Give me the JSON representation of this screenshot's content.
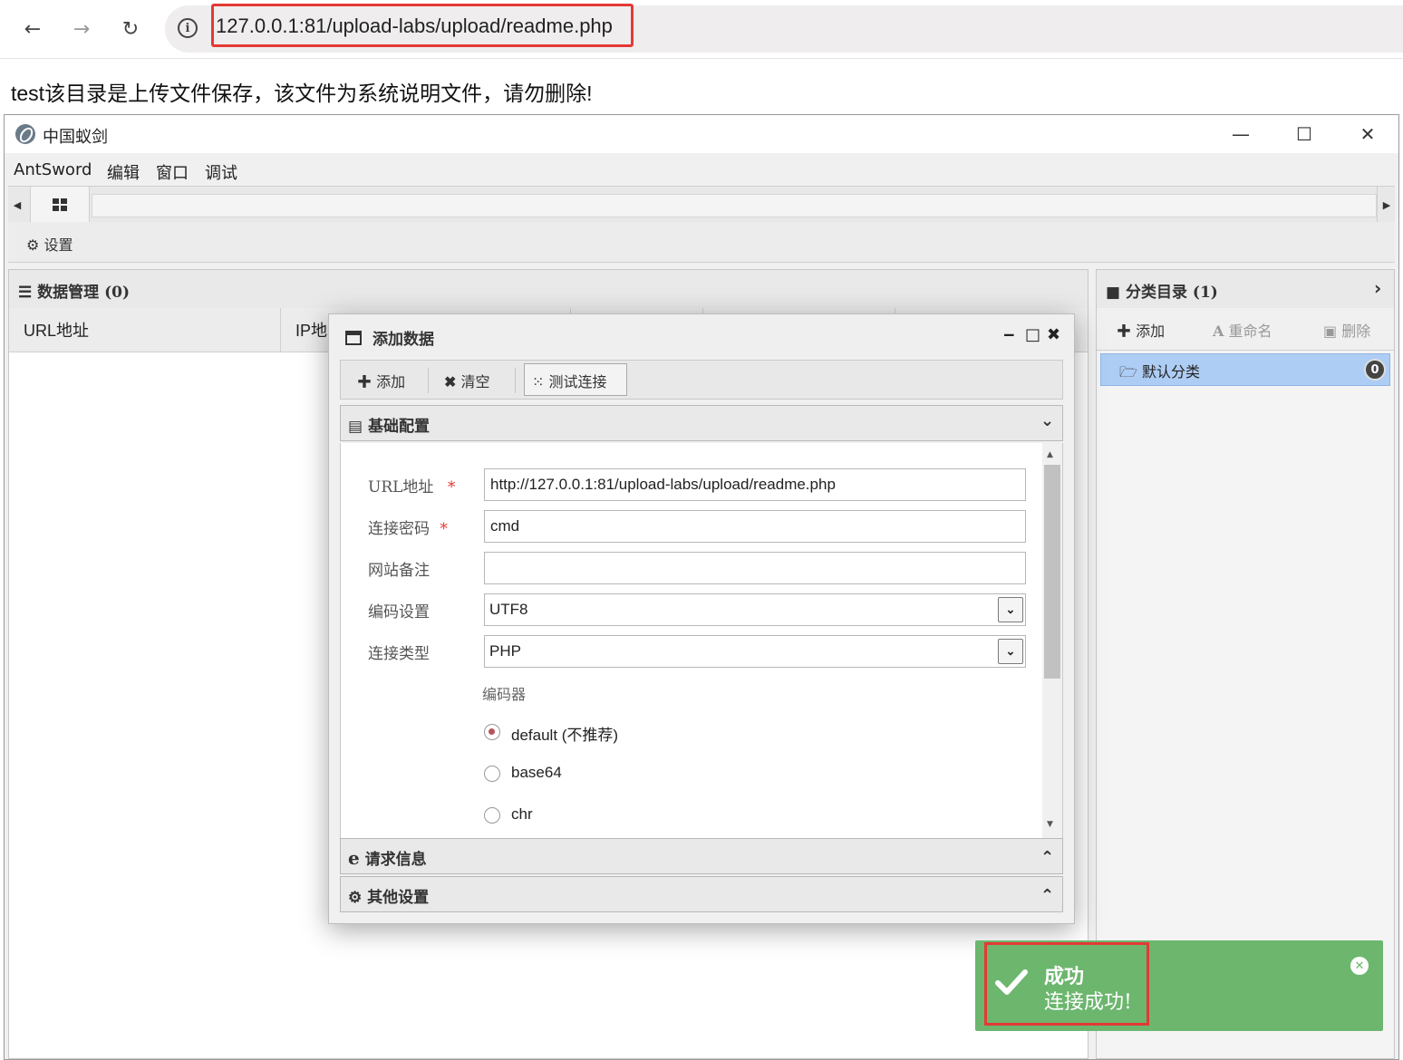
{
  "browser": {
    "url": "127.0.0.1:81/upload-labs/upload/readme.php"
  },
  "page": {
    "text": "test该目录是上传文件保存，该文件为系统说明文件，请勿删除!"
  },
  "app": {
    "title": "中国蚁剑",
    "menu": [
      "AntSword",
      "编辑",
      "窗口",
      "调试"
    ],
    "settings_label": "设置"
  },
  "data_panel": {
    "title": "数据管理 (0)",
    "columns": [
      "URL地址",
      "IP地"
    ]
  },
  "category_panel": {
    "title": "分类目录 (1)",
    "toolbar": {
      "add": "添加",
      "rename": "重命名",
      "delete": "删除"
    },
    "items": [
      {
        "label": "默认分类",
        "count": "0"
      }
    ]
  },
  "dialog": {
    "title": "添加数据",
    "toolbar": {
      "add": "添加",
      "clear": "清空",
      "test": "测试连接"
    },
    "sections": {
      "basic": "基础配置",
      "request": "请求信息",
      "other": "其他设置"
    },
    "form": {
      "url_label": "URL地址",
      "url_value": "http://127.0.0.1:81/upload-labs/upload/readme.php",
      "password_label": "连接密码",
      "password_value": "cmd",
      "note_label": "网站备注",
      "note_value": "",
      "encoding_label": "编码设置",
      "encoding_value": "UTF8",
      "type_label": "连接类型",
      "type_value": "PHP",
      "required_mark": "*",
      "encoder_label": "编码器",
      "encoders": [
        {
          "label": "default (不推荐)",
          "checked": true
        },
        {
          "label": "base64",
          "checked": false
        },
        {
          "label": "chr",
          "checked": false
        }
      ]
    }
  },
  "toast": {
    "title": "成功",
    "message": "连接成功!"
  },
  "colors": {
    "highlight": "#e53935",
    "toast_bg": "#6cb66e",
    "selected_item": "#aecdf4"
  }
}
